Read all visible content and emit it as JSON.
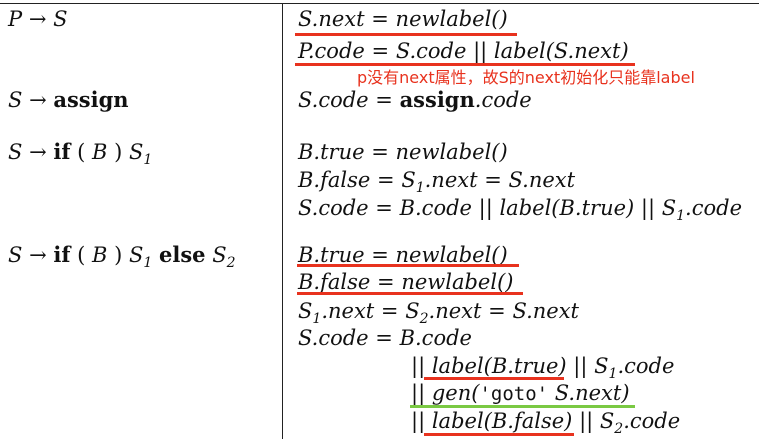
{
  "rules": [
    {
      "production": {
        "lhs": "P",
        "arrow": "→",
        "rhs": "S"
      },
      "actions": [
        {
          "pre": "S.next",
          "eq": "=",
          "post": "newlabel()"
        },
        {
          "pre": "P.code",
          "eq": "=",
          "post": "S.code || label(S.next)"
        }
      ]
    },
    {
      "production": {
        "lhs": "S",
        "arrow": "→",
        "kw": "assign"
      },
      "actions": [
        {
          "pre": "S.code",
          "eq": "=",
          "kw": "assign",
          "post": ".code"
        }
      ]
    },
    {
      "production": {
        "lhs": "S",
        "arrow": "→",
        "kw_if": "if",
        "lp": "(",
        "b": "B",
        "rp": ")",
        "s": "S",
        "s_sub": "1"
      },
      "actions": [
        {
          "pre": "B.true",
          "eq": "=",
          "post": "newlabel()"
        },
        {
          "pre": "B.false",
          "eq": "=",
          "s": "S",
          "s_sub": "1",
          "mid": ".next",
          "eq2": "=",
          "post": "S.next"
        },
        {
          "pre": "S.code",
          "eq": "=",
          "post": "B.code || label(B.true) ||",
          "s": "S",
          "s_sub": "1",
          "tail": ".code"
        }
      ]
    },
    {
      "production": {
        "lhs": "S",
        "arrow": "→",
        "kw_if": "if",
        "lp": "(",
        "b": "B",
        "rp": ")",
        "s": "S",
        "s_sub": "1",
        "kw_else": "else",
        "s2": "S",
        "s2_sub": "2"
      },
      "actions": [
        {
          "pre": "B.true",
          "eq": "=",
          "post": "newlabel()"
        },
        {
          "pre": "B.false",
          "eq": "=",
          "post": "newlabel()"
        },
        {
          "s": "S",
          "s_sub": "1",
          "mid": ".next",
          "eq": "=",
          "s2": "S",
          "s2_sub": "2",
          "mid2": ".next",
          "eq2": "=",
          "post": "S.next"
        },
        {
          "pre": "S.code",
          "eq": "=",
          "post": "B.code"
        },
        {
          "bar": "||",
          "post": "label(B.true)",
          "bar2": "||",
          "s": "S",
          "s_sub": "1",
          "tail": ".code"
        },
        {
          "bar": "||",
          "gen": "gen(",
          "str": "'goto'",
          "post": "S.next)"
        },
        {
          "bar": "||",
          "post": "label(B.false)",
          "bar2": "||",
          "s": "S",
          "s_sub": "2",
          "tail": ".code"
        }
      ]
    }
  ],
  "annotation": "p没有next属性，故S的next初始化只能靠label",
  "colors": {
    "highlight_red": "#e8321e",
    "highlight_green": "#7ac943",
    "rule": "#222222"
  }
}
